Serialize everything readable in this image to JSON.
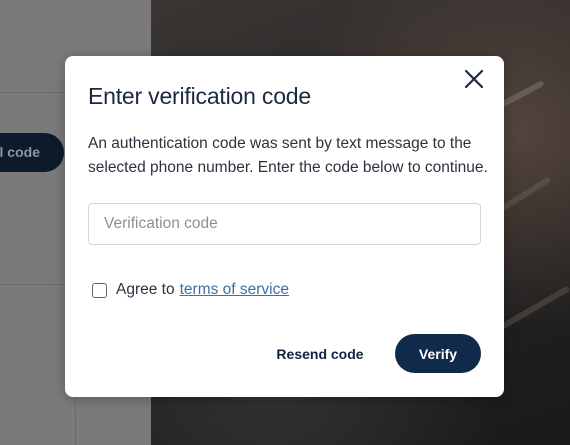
{
  "background": {
    "partial_button_label": "l code"
  },
  "dialog": {
    "title": "Enter verification code",
    "close_icon": "close-icon",
    "message": "An authentication code was sent by text message to the selected phone number. Enter the code below to continue.",
    "code_input": {
      "value": "",
      "placeholder": "Verification code"
    },
    "agree": {
      "checked": false,
      "label": "Agree to",
      "link_text": "terms of service"
    },
    "resend_label": "Resend code",
    "verify_label": "Verify"
  },
  "colors": {
    "primary": "#102a4c",
    "link": "#3a6fa8",
    "text": "#2b3340",
    "title": "#1c2a3d"
  }
}
